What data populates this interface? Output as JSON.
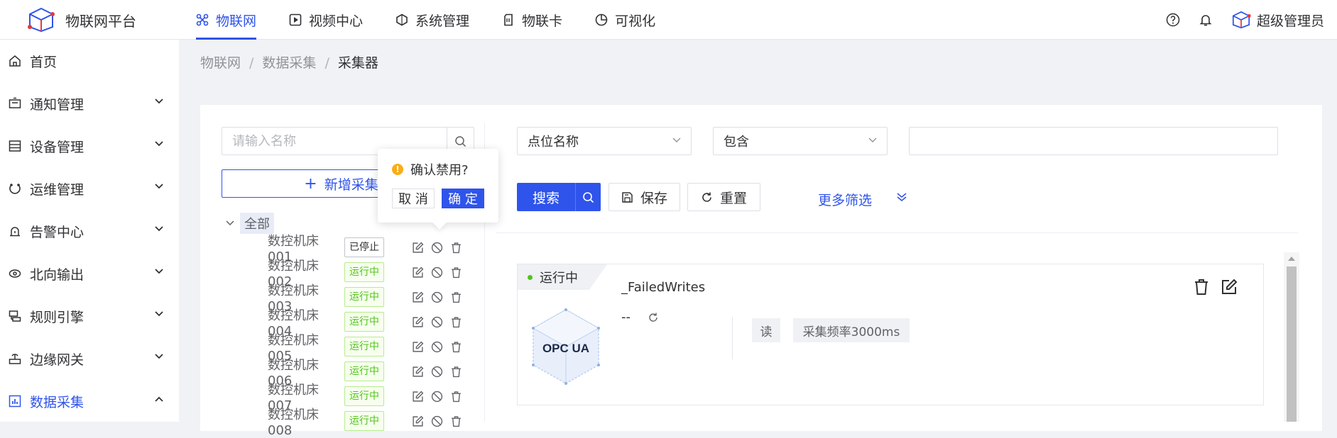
{
  "header": {
    "brand": "物联网平台",
    "nav": [
      {
        "label": "物联网",
        "icon": "iot-icon",
        "active": true
      },
      {
        "label": "视频中心",
        "icon": "video-icon",
        "active": false
      },
      {
        "label": "系统管理",
        "icon": "system-icon",
        "active": false
      },
      {
        "label": "物联卡",
        "icon": "sim-card-icon",
        "active": false
      },
      {
        "label": "可视化",
        "icon": "pie-chart-icon",
        "active": false
      }
    ],
    "user_name": "超级管理员"
  },
  "sidebar": {
    "items": [
      {
        "label": "首页",
        "icon": "home-icon",
        "expandable": false
      },
      {
        "label": "通知管理",
        "icon": "notification-icon",
        "expandable": true
      },
      {
        "label": "设备管理",
        "icon": "device-icon",
        "expandable": true
      },
      {
        "label": "运维管理",
        "icon": "ops-icon",
        "expandable": true
      },
      {
        "label": "告警中心",
        "icon": "alarm-icon",
        "expandable": true
      },
      {
        "label": "北向输出",
        "icon": "output-icon",
        "expandable": true
      },
      {
        "label": "规则引擎",
        "icon": "rule-icon",
        "expandable": true
      },
      {
        "label": "边缘网关",
        "icon": "gateway-icon",
        "expandable": true
      },
      {
        "label": "数据采集",
        "icon": "data-collect-icon",
        "expandable": true,
        "active": true
      }
    ]
  },
  "breadcrumb": [
    "物联网",
    "数据采集",
    "采集器"
  ],
  "left_panel": {
    "search_placeholder": "请输入名称",
    "add_button": "新增采集器",
    "tree_root": "全部",
    "nodes": [
      {
        "name": "数控机床001",
        "status": "已停止"
      },
      {
        "name": "数控机床002",
        "status": "运行中"
      },
      {
        "name": "数控机床003",
        "status": "运行中"
      },
      {
        "name": "数控机床004",
        "status": "运行中"
      },
      {
        "name": "数控机床005",
        "status": "运行中"
      },
      {
        "name": "数控机床006",
        "status": "运行中"
      },
      {
        "name": "数控机床007",
        "status": "运行中"
      },
      {
        "name": "数控机床008",
        "status": "运行中"
      }
    ]
  },
  "popconfirm": {
    "title": "确认禁用?",
    "cancel": "取 消",
    "ok": "确 定"
  },
  "filter": {
    "field_select": "点位名称",
    "operator_select": "包含",
    "value": "",
    "search_button": "搜索",
    "save_button": "保存",
    "reset_button": "重置",
    "more_filter": "更多筛选"
  },
  "point_card": {
    "status": "运行中",
    "logo_text": "OPC UA",
    "name": "_FailedWrites",
    "value": "--",
    "tags": [
      "读",
      "采集频率3000ms"
    ]
  },
  "colors": {
    "primary": "#2f54eb",
    "running": "#52c41a",
    "warning": "#faad14"
  }
}
